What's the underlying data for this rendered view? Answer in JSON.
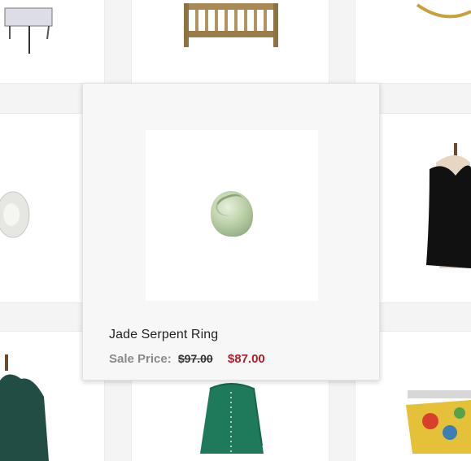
{
  "quick_view": {
    "product_name": "Jade Serpent Ring",
    "sale_label": "Sale Price:",
    "original_price": "$97.00",
    "sale_price": "$87.00",
    "colors": {
      "sale_price": "#b01e2a",
      "label": "#8a8a8a"
    }
  }
}
